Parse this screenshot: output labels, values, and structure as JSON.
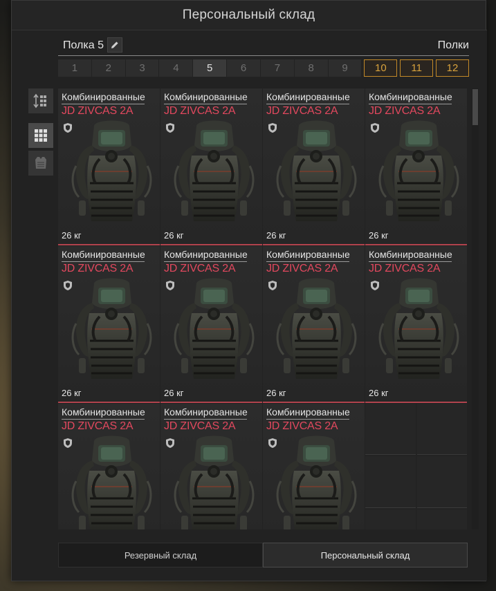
{
  "window": {
    "title": "Персональный склад"
  },
  "shelf": {
    "name": "Полка 5",
    "shelves_label": "Полки"
  },
  "tabs": [
    {
      "label": "1",
      "state": "normal"
    },
    {
      "label": "2",
      "state": "normal"
    },
    {
      "label": "3",
      "state": "normal"
    },
    {
      "label": "4",
      "state": "normal"
    },
    {
      "label": "5",
      "state": "active"
    },
    {
      "label": "6",
      "state": "normal"
    },
    {
      "label": "7",
      "state": "normal"
    },
    {
      "label": "8",
      "state": "normal"
    },
    {
      "label": "9",
      "state": "normal"
    },
    {
      "label": "10",
      "state": "gold"
    },
    {
      "label": "11",
      "state": "gold"
    },
    {
      "label": "12",
      "state": "gold"
    }
  ],
  "side_buttons": [
    {
      "icon": "sort-icon"
    },
    {
      "icon": "grid-view-icon",
      "active": true
    },
    {
      "icon": "armor-filter-icon"
    }
  ],
  "items": [
    {
      "category": "Комбинированные",
      "name": "JD ZIVCAS 2A",
      "weight": "26 кг"
    },
    {
      "category": "Комбинированные",
      "name": "JD ZIVCAS 2A",
      "weight": "26 кг"
    },
    {
      "category": "Комбинированные",
      "name": "JD ZIVCAS 2A",
      "weight": "26 кг"
    },
    {
      "category": "Комбинированные",
      "name": "JD ZIVCAS 2A",
      "weight": "26 кг"
    },
    {
      "category": "Комбинированные",
      "name": "JD ZIVCAS 2A",
      "weight": "26 кг"
    },
    {
      "category": "Комбинированные",
      "name": "JD ZIVCAS 2A",
      "weight": "26 кг"
    },
    {
      "category": "Комбинированные",
      "name": "JD ZIVCAS 2A",
      "weight": "26 кг"
    },
    {
      "category": "Комбинированные",
      "name": "JD ZIVCAS 2A",
      "weight": "26 кг"
    },
    {
      "category": "Комбинированные",
      "name": "JD ZIVCAS 2A",
      "weight": ""
    },
    {
      "category": "Комбинированные",
      "name": "JD ZIVCAS 2A",
      "weight": ""
    },
    {
      "category": "Комбинированные",
      "name": "JD ZIVCAS 2A",
      "weight": ""
    }
  ],
  "bottom_tabs": [
    {
      "label": "Резервный склад",
      "active": false
    },
    {
      "label": "Персональный склад",
      "active": true
    }
  ],
  "colors": {
    "item_name": "#e2485e",
    "gold_tab": "#d8a23d",
    "rarity_line": "#b1434d"
  }
}
